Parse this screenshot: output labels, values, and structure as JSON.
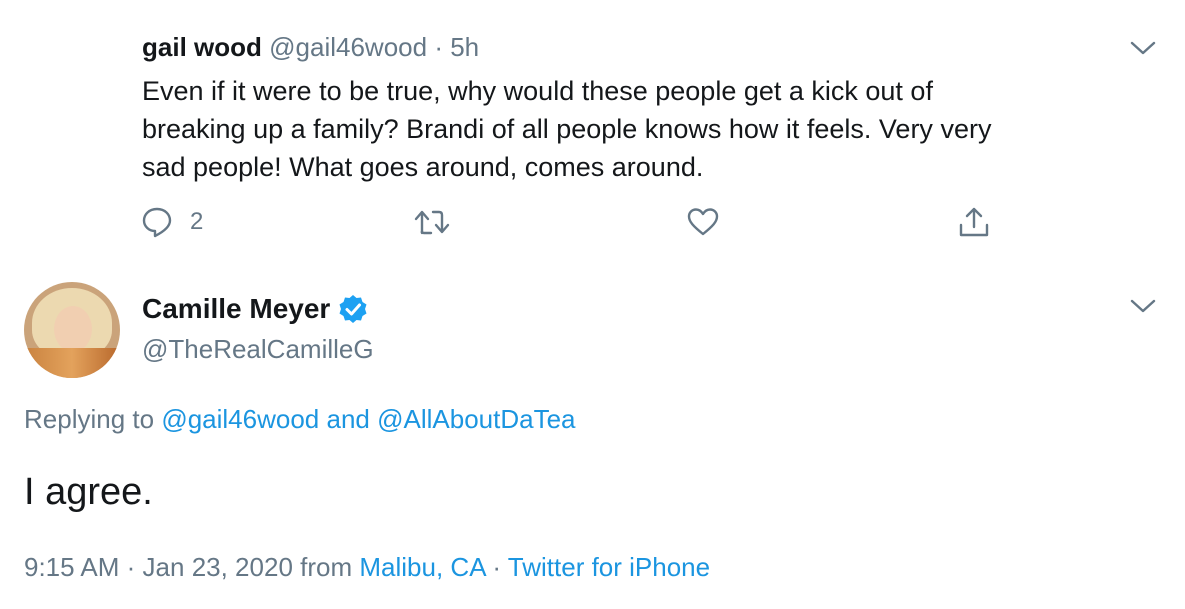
{
  "reply_tweet": {
    "author_name": "gail wood",
    "author_handle": "@gail46wood",
    "separator": "·",
    "time": "5h",
    "text_lines": [
      "Even if it were to be true, why would these people get a kick out of",
      "breaking up a family? Brandi of all people knows how it feels. Very very",
      "sad people! What goes around, comes around."
    ],
    "actions": {
      "reply_count": "2",
      "reply_icon": "reply-icon",
      "retweet_icon": "retweet-icon",
      "like_icon": "heart-icon",
      "share_icon": "share-icon"
    },
    "menu_icon": "chevron-down-icon"
  },
  "main_tweet": {
    "author_name": "Camille Meyer",
    "author_handle": "@TheRealCamilleG",
    "verified_icon": "verified-badge-icon",
    "menu_icon": "chevron-down-icon",
    "replying_prefix": "Replying to",
    "replying_user1": "@gail46wood",
    "replying_and": "and",
    "replying_user2": "@AllAboutDaTea",
    "text": "I agree.",
    "time": "9:15 AM",
    "meta_sep1": "·",
    "date": "Jan 23, 2020",
    "from_word": "from",
    "location": "Malibu, CA",
    "meta_sep2": "·",
    "source": "Twitter for iPhone"
  },
  "colors": {
    "text_primary": "#14171a",
    "text_secondary": "#657786",
    "link": "#1b95e0",
    "verified": "#1da1f2"
  }
}
